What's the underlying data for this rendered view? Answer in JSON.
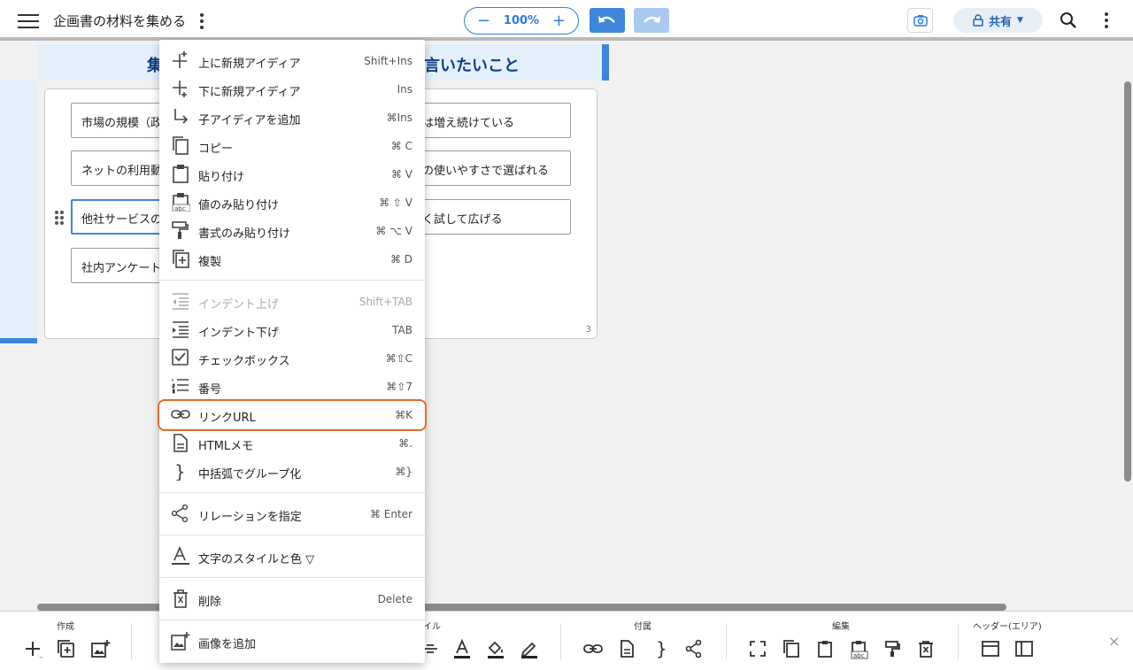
{
  "app": {
    "doc_title": "企画書の材料を集める",
    "zoom": "100%",
    "zoom_minus": "−",
    "zoom_plus": "+",
    "share_label": "共有"
  },
  "canvas": {
    "header_left": "集",
    "header_right": "言いたいこと",
    "page_number": "3",
    "cards": [
      {
        "text": "市場の規模（政"
      },
      {
        "text": "は増え続けている"
      },
      {
        "text": "ネットの利用動"
      },
      {
        "text": "の使いやすさで選ばれる"
      },
      {
        "text": "他社サービスの"
      },
      {
        "text": "く試して広げる"
      },
      {
        "text": "社内アンケート"
      }
    ]
  },
  "menu": {
    "items": [
      {
        "label": "上に新規アイディア",
        "shortcut": "Shift+Ins",
        "icon": "add-above-icon"
      },
      {
        "label": "下に新規アイディア",
        "shortcut": "Ins",
        "icon": "add-below-icon"
      },
      {
        "label": "子アイディアを追加",
        "shortcut": "⌘Ins",
        "icon": "child-arrow-icon"
      },
      {
        "label": "コピー",
        "shortcut": "⌘ C",
        "icon": "copy-icon"
      },
      {
        "label": "貼り付け",
        "shortcut": "⌘ V",
        "icon": "paste-icon"
      },
      {
        "label": "値のみ貼り付け",
        "shortcut": "⌘ ⇧ V",
        "icon": "paste-text-icon"
      },
      {
        "label": "書式のみ貼り付け",
        "shortcut": "⌘ ⌥ V",
        "icon": "paint-roller-icon"
      },
      {
        "label": "複製",
        "shortcut": "⌘ D",
        "icon": "duplicate-icon"
      },
      {
        "label": "インデント上げ",
        "shortcut": "Shift+TAB",
        "icon": "outdent-icon",
        "disabled": true
      },
      {
        "label": "インデント下げ",
        "shortcut": "TAB",
        "icon": "indent-icon"
      },
      {
        "label": "チェックボックス",
        "shortcut": "⌘⇧C",
        "icon": "checkbox-icon"
      },
      {
        "label": "番号",
        "shortcut": "⌘⇧7",
        "icon": "numbered-list-icon"
      },
      {
        "label": "リンクURL",
        "shortcut": "⌘K",
        "icon": "link-icon",
        "highlight": true
      },
      {
        "label": "HTMLメモ",
        "shortcut": "⌘.",
        "icon": "document-icon"
      },
      {
        "label": "中括弧でグループ化",
        "shortcut": "⌘}",
        "icon": "brace-icon"
      },
      {
        "label": "リレーションを指定",
        "shortcut": "⌘ Enter",
        "icon": "relation-icon"
      },
      {
        "label": "文字のスタイルと色 ▽",
        "shortcut": "",
        "icon": "text-style-icon"
      },
      {
        "label": "削除",
        "shortcut": "Delete",
        "icon": "delete-icon"
      },
      {
        "label": "画像を追加",
        "shortcut": "",
        "icon": "add-image-icon"
      }
    ]
  },
  "toolbar": {
    "group_create": "作成",
    "group_style": "イル",
    "group_attach": "付属",
    "group_edit": "編集",
    "group_header": "ヘッダー(エリア)",
    "close": "×"
  },
  "colors": {
    "accent": "#3e86dc",
    "highlight_outline": "#e06c2a",
    "lane_bg": "#e3f0fb",
    "header_text": "#0d3f86"
  }
}
